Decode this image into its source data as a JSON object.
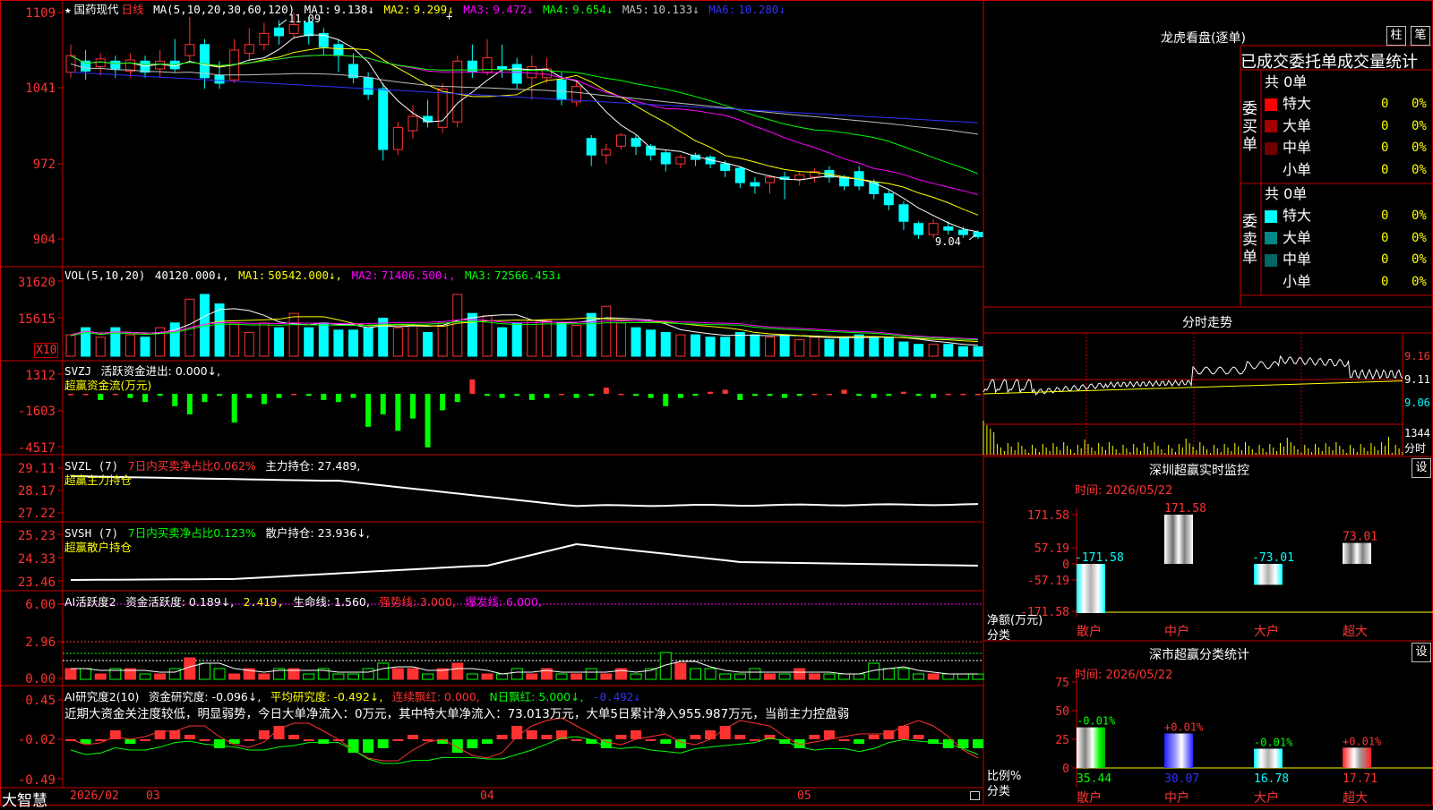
{
  "stock": {
    "star": "★",
    "name": "国药现代",
    "period": "日线"
  },
  "colors": {
    "up": "#ff3232",
    "down": "#00ffff",
    "frame": "#c80000",
    "ma1": "#ffffff",
    "ma2": "#ffff00",
    "ma3": "#ff00ff",
    "ma4": "#00ff00",
    "ma5": "#c0c0c0",
    "ma6": "#3030ff"
  },
  "kline": {
    "indicator": "MA(5,10,20,30,60,120)",
    "ma": [
      {
        "label": "MA1:",
        "value": "9.138↓"
      },
      {
        "label": "MA2:",
        "value": "9.299↓"
      },
      {
        "label": "MA3:",
        "value": "9.472↓"
      },
      {
        "label": "MA4:",
        "value": "9.654↓"
      },
      {
        "label": "MA5:",
        "value": "10.133↓"
      },
      {
        "label": "MA6:",
        "value": "10.280↓"
      }
    ],
    "yticks": [
      "1109",
      "1041",
      "972",
      "904"
    ],
    "high_mark": "11.09",
    "low_mark": "9.04"
  },
  "chart_data": {
    "type": "candlestick",
    "ylim": [
      9.0,
      11.12
    ],
    "high": 11.09,
    "low": 9.04,
    "candles": [
      [
        10.55,
        10.7,
        10.8,
        10.5
      ],
      [
        10.65,
        10.56,
        10.75,
        10.48
      ],
      [
        10.6,
        10.67,
        10.72,
        10.52
      ],
      [
        10.65,
        10.58,
        10.7,
        10.5
      ],
      [
        10.56,
        10.66,
        10.72,
        10.5
      ],
      [
        10.65,
        10.55,
        10.7,
        10.5
      ],
      [
        10.58,
        10.65,
        10.75,
        10.5
      ],
      [
        10.65,
        10.58,
        10.85,
        10.55
      ],
      [
        10.7,
        10.8,
        11.05,
        10.65
      ],
      [
        10.8,
        10.5,
        10.85,
        10.4
      ],
      [
        10.52,
        10.45,
        10.65,
        10.4
      ],
      [
        10.48,
        10.75,
        10.85,
        10.45
      ],
      [
        10.72,
        10.8,
        10.95,
        10.65
      ],
      [
        10.8,
        10.9,
        11.0,
        10.75
      ],
      [
        10.95,
        10.88,
        11.02,
        10.8
      ],
      [
        10.9,
        10.98,
        11.09,
        10.85
      ],
      [
        11.0,
        10.88,
        11.05,
        10.8
      ],
      [
        10.9,
        10.78,
        10.95,
        10.7
      ],
      [
        10.8,
        10.7,
        10.85,
        10.55
      ],
      [
        10.62,
        10.5,
        10.72,
        10.45
      ],
      [
        10.5,
        10.35,
        10.55,
        10.3
      ],
      [
        10.4,
        9.85,
        10.45,
        9.75
      ],
      [
        9.85,
        10.05,
        10.1,
        9.8
      ],
      [
        10.02,
        10.15,
        10.25,
        9.95
      ],
      [
        10.15,
        10.1,
        10.3,
        10.05
      ],
      [
        10.05,
        10.4,
        10.45,
        10.0
      ],
      [
        10.1,
        10.65,
        10.7,
        10.05
      ],
      [
        10.65,
        10.55,
        10.8,
        10.5
      ],
      [
        10.55,
        10.68,
        10.85,
        10.52
      ],
      [
        10.6,
        10.58,
        10.8,
        10.5
      ],
      [
        10.62,
        10.45,
        10.68,
        10.4
      ],
      [
        10.5,
        10.6,
        10.7,
        10.3
      ],
      [
        10.5,
        10.58,
        10.68,
        10.45
      ],
      [
        10.48,
        10.3,
        10.55,
        10.25
      ],
      [
        10.28,
        10.42,
        10.48,
        10.24
      ],
      [
        9.95,
        9.8,
        9.98,
        9.7
      ],
      [
        9.8,
        9.85,
        9.9,
        9.72
      ],
      [
        9.88,
        9.98,
        10.0,
        9.85
      ],
      [
        9.95,
        9.88,
        9.98,
        9.8
      ],
      [
        9.88,
        9.8,
        9.9,
        9.75
      ],
      [
        9.82,
        9.72,
        9.85,
        9.65
      ],
      [
        9.72,
        9.78,
        9.8,
        9.68
      ],
      [
        9.8,
        9.76,
        9.82,
        9.7
      ],
      [
        9.78,
        9.72,
        9.8,
        9.68
      ],
      [
        9.72,
        9.66,
        9.75,
        9.6
      ],
      [
        9.68,
        9.55,
        9.7,
        9.5
      ],
      [
        9.55,
        9.52,
        9.6,
        9.45
      ],
      [
        9.55,
        9.6,
        9.62,
        9.45
      ],
      [
        9.6,
        9.58,
        9.65,
        9.4
      ],
      [
        9.58,
        9.62,
        9.65,
        9.52
      ],
      [
        9.6,
        9.65,
        9.68,
        9.55
      ],
      [
        9.66,
        9.6,
        9.7,
        9.55
      ],
      [
        9.6,
        9.52,
        9.62,
        9.48
      ],
      [
        9.65,
        9.52,
        9.7,
        9.48
      ],
      [
        9.55,
        9.45,
        9.58,
        9.4
      ],
      [
        9.45,
        9.35,
        9.48,
        9.3
      ],
      [
        9.35,
        9.2,
        9.38,
        9.12
      ],
      [
        9.18,
        9.08,
        9.2,
        9.04
      ],
      [
        9.08,
        9.18,
        9.22,
        9.05
      ],
      [
        9.15,
        9.12,
        9.2,
        9.08
      ],
      [
        9.12,
        9.08,
        9.15,
        9.05
      ],
      [
        9.1,
        9.06,
        9.12,
        9.04
      ]
    ],
    "vol_ylim": [
      0,
      36000
    ],
    "vol_ticks": [
      31620,
      15615
    ],
    "volumes": [
      9000,
      12000,
      8000,
      12000,
      9000,
      8000,
      12000,
      14000,
      24000,
      26000,
      22000,
      14000,
      10000,
      14000,
      12000,
      18000,
      12000,
      14000,
      11000,
      11000,
      12000,
      16000,
      12000,
      13000,
      10000,
      14000,
      26000,
      18000,
      17000,
      12000,
      14000,
      15000,
      15000,
      14000,
      13000,
      18000,
      21000,
      14000,
      12000,
      11000,
      10000,
      9000,
      9000,
      8000,
      8000,
      10000,
      9000,
      8000,
      9000,
      7000,
      8000,
      7000,
      8000,
      9000,
      8000,
      8000,
      6000,
      5000,
      5000,
      5000,
      4000,
      4000
    ]
  },
  "vol_panel": {
    "label": "VOL(5,10,20)",
    "value": "40120.000↓,",
    "ma": [
      {
        "label": "MA1:",
        "value": "50542.000↓,"
      },
      {
        "label": "MA2:",
        "value": "71406.500↓,"
      },
      {
        "label": "MA3:",
        "value": "72566.453↓"
      }
    ],
    "yticks": [
      "31620",
      "15615"
    ],
    "unit": "X10"
  },
  "svzj": {
    "label": "SVZJ",
    "text": "活跃资金进出: 0.000↓,",
    "sub": "超赢资金流(万元)",
    "yticks": [
      "1312",
      "-1603",
      "-4517"
    ]
  },
  "svzl": {
    "label": "SVZL (7)",
    "pct": "7日内买卖净占比0.062%",
    "hold": "主力持仓: 27.489,",
    "sub": "超赢主力持仓",
    "yticks": [
      "29.11",
      "28.17",
      "27.22"
    ]
  },
  "svsh": {
    "label": "SVSH (7)",
    "pct": "7日内买卖净占比0.123%",
    "hold": "散户持仓: 23.936↓,",
    "sub": "超赢散户持仓",
    "yticks": [
      "25.23",
      "24.33",
      "23.46"
    ]
  },
  "ai_active": {
    "label": "AI活跃度2",
    "a": "资金活跃度: 0.189↓,",
    "b": "2.419,",
    "c": "生命线: 1.560,",
    "d": "强势线: 3.000,",
    "e": "爆发线: 6.000,",
    "yticks": [
      "6.00",
      "2.96",
      "0.00"
    ]
  },
  "ai_research": {
    "label": "AI研究度2(10)",
    "a": "资金研究度: -0.096↓,",
    "b": "平均研究度: -0.492↓,",
    "c": "连续飘红: 0.000,",
    "d": "N日飘红: 5.000↓,",
    "e": "-0.492↓",
    "note": "近期大资金关注度较低，明显弱势，今日大单净流入：0万元，其中特大单净流入：73.013万元，大单5日累计净入955.987万元，当前主力控盘弱",
    "yticks": [
      "0.45",
      "-0.02",
      "-0.49"
    ]
  },
  "xaxis": {
    "brand": "大智慧",
    "labels": [
      "2026/02",
      "03",
      "04",
      "05"
    ]
  },
  "lhb": {
    "title": "龙虎看盘(逐单)",
    "btn_bar": "柱",
    "btn_pen": "笔",
    "header": "已成交委托单成交量统计",
    "buy_side": "委买单",
    "sell_side": "委卖单",
    "buy_total": "共 0单",
    "sell_total": "共 0单",
    "buy_rows": [
      {
        "name": "特大",
        "count": "0",
        "pct": "0%",
        "color": "#ff0000"
      },
      {
        "name": "大单",
        "count": "0",
        "pct": "0%",
        "color": "#a00000"
      },
      {
        "name": "中单",
        "count": "0",
        "pct": "0%",
        "color": "#700000"
      },
      {
        "name": "小单",
        "count": "0",
        "pct": "0%",
        "color": "#000000"
      }
    ],
    "sell_rows": [
      {
        "name": "特大",
        "count": "0",
        "pct": "0%",
        "color": "#00ffff"
      },
      {
        "name": "大单",
        "count": "0",
        "pct": "0%",
        "color": "#008888"
      },
      {
        "name": "中单",
        "count": "0",
        "pct": "0%",
        "color": "#006666"
      },
      {
        "name": "小单",
        "count": "0",
        "pct": "0%",
        "color": "#000000"
      }
    ]
  },
  "intraday": {
    "title": "分时走势",
    "prices": [
      "9.16",
      "9.11",
      "9.06"
    ],
    "vol": "1344",
    "vol_label": "分时"
  },
  "sz_monitor": {
    "title": "深圳超赢实时监控",
    "set": "设",
    "time": "时间: 2026/05/22",
    "yticks": [
      "171.58",
      "57.19",
      "0",
      "-57.19",
      "-171.58"
    ],
    "ylabel": "净额(万元)",
    "xlabel": "分类",
    "cats": [
      "散户",
      "中户",
      "大户",
      "超大"
    ],
    "values": [
      -171.58,
      171.58,
      -73.01,
      73.01
    ],
    "value_labels": [
      "-171.58",
      "171.58",
      "-73.01",
      "73.01"
    ]
  },
  "sz_class": {
    "title": "深市超赢分类统计",
    "set": "设",
    "time": "时间: 2026/05/22",
    "yticks": [
      "75",
      "50",
      "25",
      "0"
    ],
    "ylabel": "比例%",
    "xlabel": "分类",
    "cats": [
      "散户",
      "中户",
      "大户",
      "超大"
    ],
    "values": [
      35.44,
      30.07,
      16.78,
      17.71
    ],
    "value_labels": [
      "35.44",
      "30.07",
      "16.78",
      "17.71"
    ],
    "change_labels": [
      "-0.01%",
      "+0.01%",
      "-0.01%",
      "+0.01%"
    ]
  }
}
